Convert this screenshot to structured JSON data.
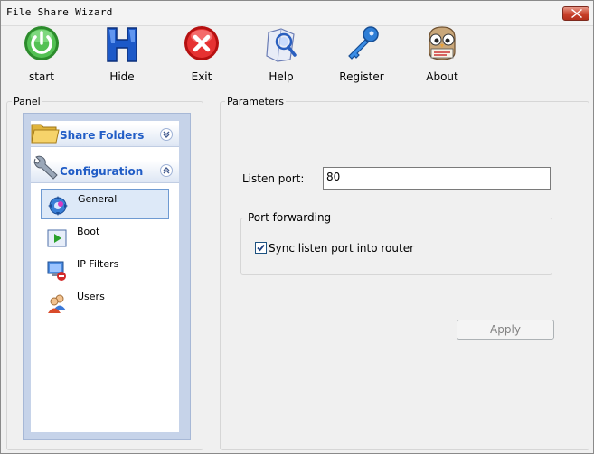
{
  "window": {
    "title": "File Share Wizard"
  },
  "toolbar": {
    "start": "start",
    "hide": "Hide",
    "exit": "Exit",
    "help": "Help",
    "register": "Register",
    "about": "About"
  },
  "panel": {
    "caption": "Panel",
    "sections": [
      {
        "title": "Share Folders",
        "icon": "folder-icon",
        "state": "collapsed"
      },
      {
        "title": "Configuration",
        "icon": "wrench-icon",
        "state": "expanded"
      }
    ],
    "items": [
      {
        "label": "General",
        "icon": "gear-icon",
        "selected": true
      },
      {
        "label": "Boot",
        "icon": "play-icon",
        "selected": false
      },
      {
        "label": "IP Filters",
        "icon": "monitor-block-icon",
        "selected": false
      },
      {
        "label": "Users",
        "icon": "users-icon",
        "selected": false
      }
    ]
  },
  "parameters": {
    "caption": "Parameters",
    "listen_port_label": "Listen port:",
    "listen_port_value": "80",
    "port_forwarding_caption": "Port forwarding",
    "sync_label": "Sync listen port into router",
    "sync_checked": true,
    "apply_label": "Apply",
    "apply_enabled": false
  },
  "colors": {
    "accent": "#215dc6",
    "sidebar_border": "#c6d3e9",
    "selection": "#dde9f8"
  }
}
